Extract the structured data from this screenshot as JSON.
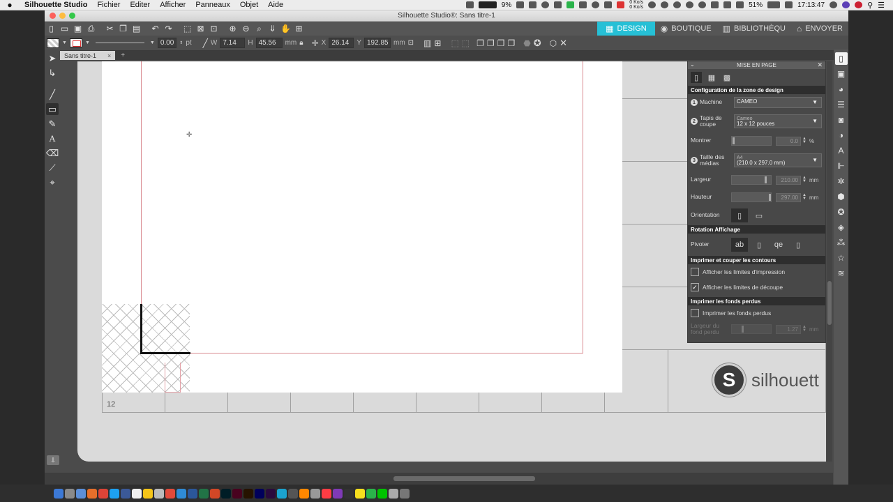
{
  "menubar": {
    "app_name": "Silhouette Studio",
    "items": [
      "Fichier",
      "Editer",
      "Afficher",
      "Panneaux",
      "Objet",
      "Aide"
    ],
    "battery": "51%",
    "time": "17:13:47",
    "cpu": "9%",
    "net_up": "0 Ko/s",
    "net_down": "0 Ko/s"
  },
  "window": {
    "title": "Silhouette Studio®: Sans titre-1",
    "traffic_colors": [
      "#fc605b",
      "#fdbc40",
      "#34c84a"
    ]
  },
  "nav_tabs": [
    {
      "label": "DESIGN",
      "icon": "grid-icon"
    },
    {
      "label": "BOUTIQUE",
      "icon": "store-icon"
    },
    {
      "label": "BIBLIOTHÈQU",
      "icon": "library-icon"
    },
    {
      "label": "ENVOYER",
      "icon": "send-icon"
    }
  ],
  "accent_color": "#26c0d6",
  "toolbar2": {
    "line_width": "0.00",
    "line_unit": "pt",
    "w_label": "W",
    "w_value": "7.14",
    "h_label": "H",
    "h_value": "45.56",
    "size_unit": "mm",
    "x_label": "X",
    "x_value": "26.14",
    "y_label": "Y",
    "y_value": "192.85",
    "pos_unit": "mm"
  },
  "doc_tab": {
    "label": "Sans titre-1",
    "close": "×",
    "add": "+"
  },
  "workspace": {
    "ruler_label": "12",
    "logo_letter": "S",
    "logo_text": "silhouett"
  },
  "panel": {
    "title": "MISE EN PAGE",
    "close": "✕",
    "sections": {
      "design_area": "Configuration de la zone de design",
      "rotation": "Rotation Affichage",
      "print_cut": "Imprimer et couper les contours",
      "bleed": "Imprimer les fonds perdus"
    },
    "machine": {
      "num": "1",
      "label": "Machine",
      "value": "CAMEO"
    },
    "mat": {
      "num": "2",
      "label": "Tapis de coupe",
      "value_line1": "Cameo",
      "value_line2": "12 x 12 pouces"
    },
    "show": {
      "label": "Montrer",
      "value": "0.0",
      "unit": "%"
    },
    "media": {
      "num": "3",
      "label": "Taille des médias",
      "value_line1": "A4",
      "value_line2": "(210.0 x 297.0 mm)"
    },
    "width": {
      "label": "Largeur",
      "value": "210.00",
      "unit": "mm"
    },
    "height": {
      "label": "Hauteur",
      "value": "297.00",
      "unit": "mm"
    },
    "orientation": {
      "label": "Orientation"
    },
    "rotate": {
      "label": "Pivoter"
    },
    "checks": [
      {
        "label": "Afficher les limites d'impression",
        "checked": false
      },
      {
        "label": "Afficher les limites de découpe",
        "checked": true
      }
    ],
    "bleed_check": {
      "label": "Imprimer les fonds perdus",
      "checked": false
    },
    "bleed_width": {
      "label": "Largeur du fond perdu",
      "value": "1.27",
      "unit": "mm"
    }
  }
}
